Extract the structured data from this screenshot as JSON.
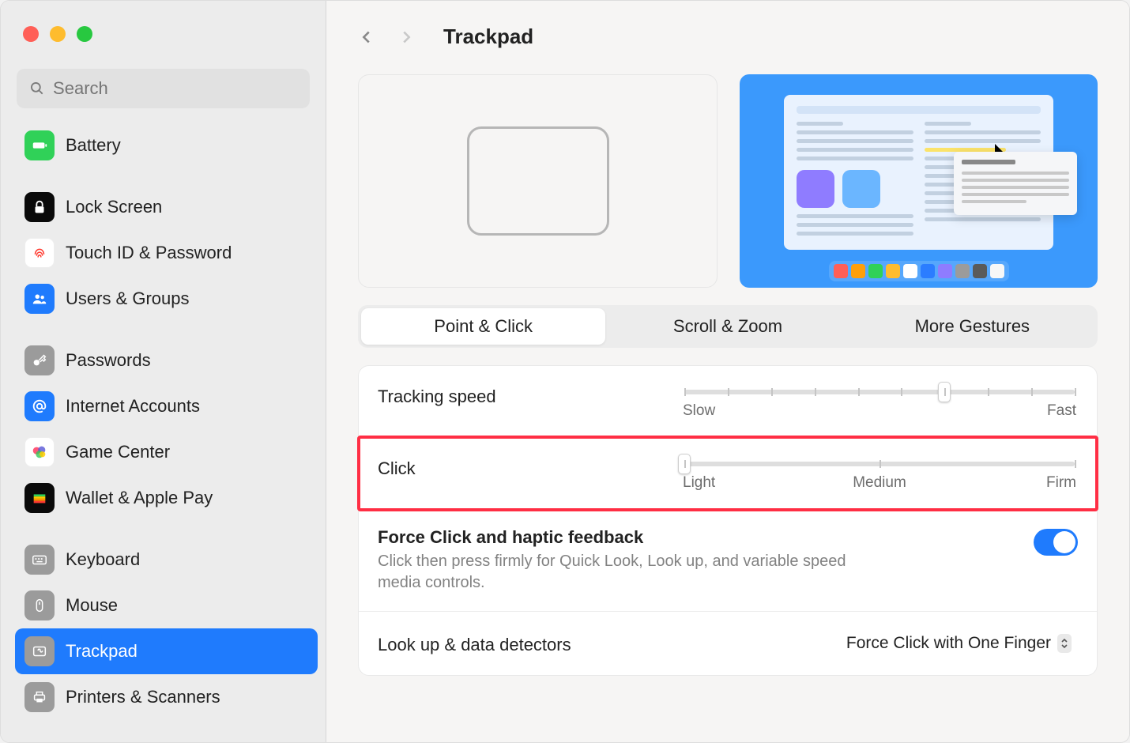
{
  "search": {
    "placeholder": "Search"
  },
  "header": {
    "title": "Trackpad"
  },
  "sidebar": {
    "items": [
      {
        "id": "battery",
        "label": "Battery",
        "icon": "battery-icon",
        "bg": "#30d158"
      },
      {
        "id": "lock",
        "label": "Lock Screen",
        "icon": "lock-icon",
        "bg": "#0a0a0a"
      },
      {
        "id": "touchid",
        "label": "Touch ID & Password",
        "icon": "fingerprint-icon",
        "bg": "#ffffff"
      },
      {
        "id": "users",
        "label": "Users & Groups",
        "icon": "users-icon",
        "bg": "#1f7bfd"
      },
      {
        "id": "passwords",
        "label": "Passwords",
        "icon": "key-icon",
        "bg": "#9b9b9b"
      },
      {
        "id": "internet",
        "label": "Internet Accounts",
        "icon": "at-icon",
        "bg": "#1f7bfd"
      },
      {
        "id": "gamecenter",
        "label": "Game Center",
        "icon": "gamecenter-icon",
        "bg": "#ffffff"
      },
      {
        "id": "wallet",
        "label": "Wallet & Apple Pay",
        "icon": "wallet-icon",
        "bg": "#0a0a0a"
      },
      {
        "id": "keyboard",
        "label": "Keyboard",
        "icon": "keyboard-icon",
        "bg": "#9b9b9b"
      },
      {
        "id": "mouse",
        "label": "Mouse",
        "icon": "mouse-icon",
        "bg": "#9b9b9b"
      },
      {
        "id": "trackpad",
        "label": "Trackpad",
        "icon": "trackpad-icon",
        "bg": "#9b9b9b",
        "selected": true
      },
      {
        "id": "printers",
        "label": "Printers & Scanners",
        "icon": "printer-icon",
        "bg": "#9b9b9b"
      }
    ]
  },
  "tabs": [
    {
      "label": "Point & Click",
      "active": true
    },
    {
      "label": "Scroll & Zoom",
      "active": false
    },
    {
      "label": "More Gestures",
      "active": false
    }
  ],
  "tracking": {
    "label": "Tracking speed",
    "min_label": "Slow",
    "max_label": "Fast",
    "ticks": 10,
    "value_index": 6
  },
  "click": {
    "label": "Click",
    "opt1": "Light",
    "opt2": "Medium",
    "opt3": "Firm",
    "value_index": 0
  },
  "force_click": {
    "title": "Force Click and haptic feedback",
    "desc": "Click then press firmly for Quick Look, Look up, and variable speed media controls.",
    "enabled": true
  },
  "lookup": {
    "label": "Look up & data detectors",
    "value": "Force Click with One Finger"
  },
  "dock_colors": [
    "#ff5f57",
    "#ff9f0a",
    "#30d158",
    "#febc2e",
    "#ffffff",
    "#2b7dff",
    "#8f7cff",
    "#9b9b9b",
    "#5a5a5a",
    "#f7f7f7"
  ]
}
